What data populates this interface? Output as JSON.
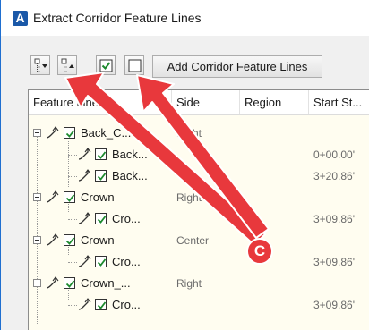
{
  "window": {
    "title": "Extract Corridor Feature Lines",
    "app_icon_letter": "A"
  },
  "toolbar": {
    "add_button_label": "Add Corridor Feature Lines"
  },
  "grid": {
    "columns": [
      "Feature Line",
      "Side",
      "Region",
      "Start St..."
    ],
    "rows": [
      {
        "label": "Back_C...",
        "side": "Right",
        "start": ""
      },
      {
        "label": "Back...",
        "side": "",
        "start": "0+00.00'"
      },
      {
        "label": "Back...",
        "side": "",
        "start": "3+20.86'"
      },
      {
        "label": "Crown",
        "side": "Right",
        "start": ""
      },
      {
        "label": "Cro...",
        "side": "",
        "start": "3+09.86'"
      },
      {
        "label": "Crown",
        "side": "Center",
        "start": ""
      },
      {
        "label": "Cro...",
        "side": "",
        "start": "3+09.86'"
      },
      {
        "label": "Crown_...",
        "side": "Right",
        "start": ""
      },
      {
        "label": "Cro...",
        "side": "",
        "start": "3+09.86'"
      }
    ]
  },
  "annotation": {
    "callout_letter": "C",
    "color": "#e8383c"
  }
}
